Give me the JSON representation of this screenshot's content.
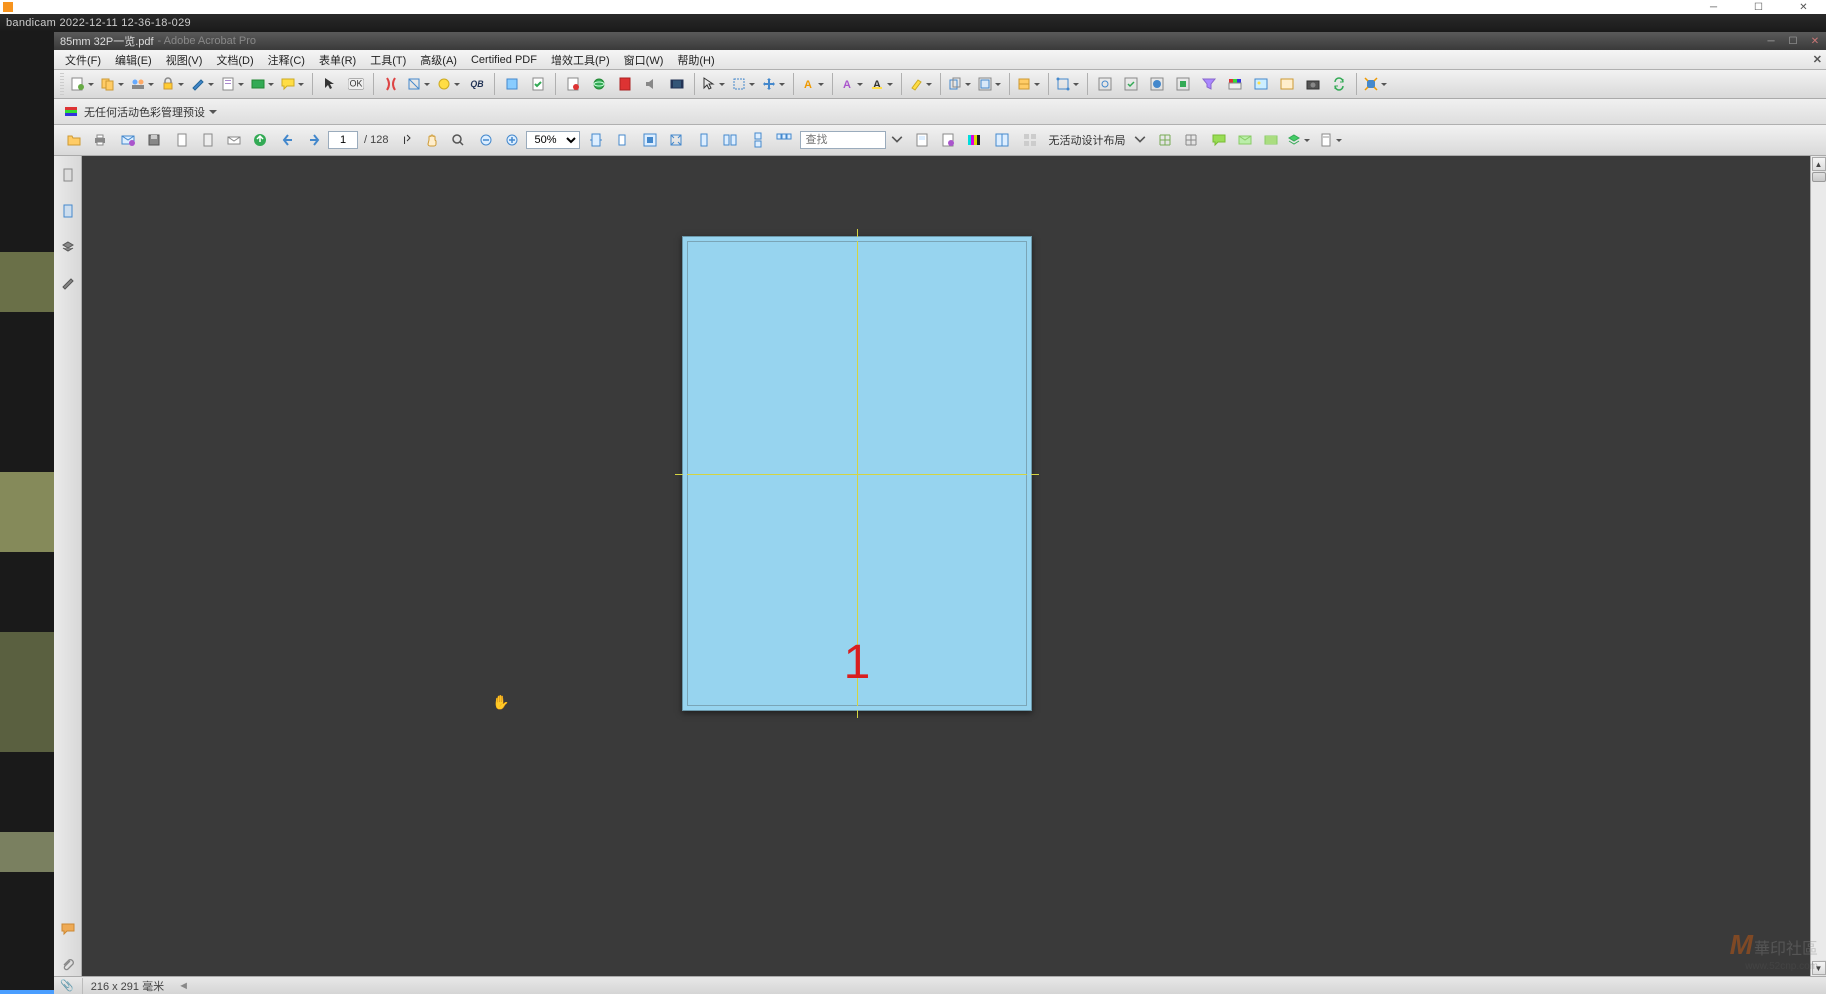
{
  "outer": {
    "bandicam": "bandicam 2022-12-11 12-36-18-029"
  },
  "app": {
    "title_prefix": "85mm 32P一览.pdf",
    "title_suffix": " - Adobe Acrobat Pro"
  },
  "menu": {
    "items": [
      "文件(F)",
      "编辑(E)",
      "视图(V)",
      "文档(D)",
      "注释(C)",
      "表单(R)",
      "工具(T)",
      "高级(A)",
      "Certified PDF",
      "增效工具(P)",
      "窗口(W)",
      "帮助(H)"
    ]
  },
  "preset": {
    "label": "无任何活动色彩管理预设"
  },
  "nav": {
    "current_page": "1",
    "total_pages": "/ 128",
    "zoom": "50%",
    "search_placeholder": "查找",
    "layout_label": "无活动设计布局"
  },
  "document": {
    "page_number": "1"
  },
  "status": {
    "dimensions": "216 x 291 毫米"
  },
  "toolbar_icons": {
    "ok": "OK",
    "qb": "QB"
  },
  "watermark": {
    "logo": "M",
    "text": "華印社區",
    "url": "www.52cnp.com"
  }
}
